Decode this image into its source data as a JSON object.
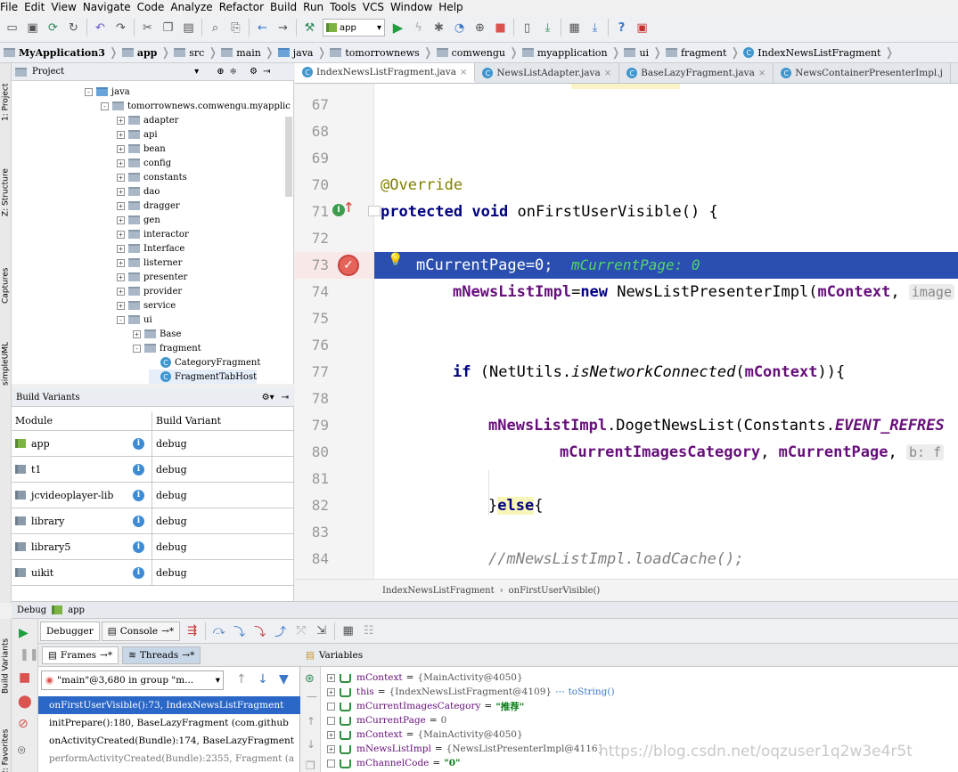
{
  "menu": [
    "File",
    "Edit",
    "View",
    "Navigate",
    "Code",
    "Analyze",
    "Refactor",
    "Build",
    "Run",
    "Tools",
    "VCS",
    "Window",
    "Help"
  ],
  "toolbar": {
    "run_config": "app"
  },
  "breadcrumb": [
    "MyApplication3",
    "app",
    "src",
    "main",
    "java",
    "tomorrownews",
    "comwengu",
    "myapplication",
    "ui",
    "fragment",
    "IndexNewsListFragment"
  ],
  "left_strip": {
    "project": "1: Project",
    "structure": "Z: Structure",
    "captures": "Captures",
    "simpleuml": "simpleUML",
    "build_variants": "Build Variants",
    "favorites": "2: Favorites"
  },
  "project_panel": {
    "title": "Project",
    "tree": [
      {
        "label": "java",
        "kind": "folder",
        "expander": "-"
      },
      {
        "label": "tomorrownews.comwengu.myapplic",
        "kind": "package",
        "expander": "-"
      },
      {
        "label": "adapter",
        "kind": "package",
        "expander": "+"
      },
      {
        "label": "api",
        "kind": "package",
        "expander": "+"
      },
      {
        "label": "bean",
        "kind": "package",
        "expander": "+"
      },
      {
        "label": "config",
        "kind": "package",
        "expander": "+"
      },
      {
        "label": "constants",
        "kind": "package",
        "expander": "+"
      },
      {
        "label": "dao",
        "kind": "package",
        "expander": "+"
      },
      {
        "label": "dragger",
        "kind": "package",
        "expander": "+"
      },
      {
        "label": "gen",
        "kind": "package",
        "expander": "+"
      },
      {
        "label": "interactor",
        "kind": "package",
        "expander": "+"
      },
      {
        "label": "Interface",
        "kind": "package",
        "expander": "+"
      },
      {
        "label": "listerner",
        "kind": "package",
        "expander": "+"
      },
      {
        "label": "presenter",
        "kind": "package",
        "expander": "+"
      },
      {
        "label": "provider",
        "kind": "package",
        "expander": "+"
      },
      {
        "label": "service",
        "kind": "package",
        "expander": "+"
      },
      {
        "label": "ui",
        "kind": "package",
        "expander": "-"
      },
      {
        "label": "Base",
        "kind": "package",
        "expander": "+"
      },
      {
        "label": "fragment",
        "kind": "package",
        "expander": "-"
      },
      {
        "label": "CategoryFragment",
        "kind": "class",
        "expander": ""
      },
      {
        "label": "FragmentTabHost",
        "kind": "class",
        "expander": ""
      }
    ]
  },
  "build_variants": {
    "title": "Build Variants",
    "col_module": "Module",
    "col_variant": "Build Variant",
    "rows": [
      {
        "module": "app",
        "variant": "debug"
      },
      {
        "module": "t1",
        "variant": "debug"
      },
      {
        "module": "jcvideoplayer-lib",
        "variant": "debug"
      },
      {
        "module": "library",
        "variant": "debug"
      },
      {
        "module": "library5",
        "variant": "debug"
      },
      {
        "module": "uikit",
        "variant": "debug"
      }
    ]
  },
  "editor_tabs": [
    "IndexNewsListFragment.java",
    "NewsListAdapter.java",
    "BaseLazyFragment.java",
    "NewsContainerPresenterImpl.j"
  ],
  "editor": {
    "line_numbers": [
      "67",
      "68",
      "69",
      "70",
      "71",
      "72",
      "73",
      "74",
      "75",
      "76",
      "77",
      "78",
      "79",
      "80",
      "81",
      "82",
      "83",
      "84"
    ],
    "l70": "@Override",
    "l71_kw": "protected void",
    "l71_rest": "onFirstUserVisible() {",
    "l73_code": "mCurrentPage=0;",
    "l73_inline": "mCurrentPage: 0",
    "l74_field": "mNewsListImpl",
    "l74_op": "=",
    "l74_kw": "new",
    "l74_rest": "NewsListPresenterImpl(",
    "l74_arg": "mContext",
    "l74_comma": ",",
    "l74_hint": "image",
    "l77_kw": "if",
    "l77_a": "(NetUtils.",
    "l77_method": "isNetworkConnected",
    "l77_b": "(",
    "l77_arg": "mContext",
    "l77_c": ")){",
    "l79_field": "mNewsListImpl",
    "l79_a": ".DogetNewsList(Constants.",
    "l79_const": "EVENT_REFRES",
    "l80_a": "mCurrentImagesCategory",
    "l80_sep": ",",
    "l80_b": "mCurrentPage",
    "l80_comma": ",",
    "l80_hint": "b: f",
    "l82_a": "}",
    "l82_kw": "else",
    "l82_b": "{",
    "l84": "//mNewsListImpl.loadCache();"
  },
  "editor_breadcrumb": {
    "file": "IndexNewsListFragment",
    "sep": "›",
    "method": "onFirstUserVisible()"
  },
  "debug": {
    "label": "Debug",
    "config": "app",
    "tab_debugger": "Debugger",
    "tab_console": "Console",
    "tab_frames": "Frames",
    "tab_threads": "Threads",
    "thread": "\"main\"@3,680 in group \"m...",
    "frames": [
      "onFirstUserVisible():73, IndexNewsListFragment",
      "initPrepare():180, BaseLazyFragment (com.github",
      "onActivityCreated(Bundle):174, BaseLazyFragment",
      "performActivityCreated(Bundle):2355, Fragment (a"
    ],
    "variables_title": "Variables",
    "variables": [
      {
        "name": "mContext",
        "eq": "=",
        "value": "{MainActivity@4050}",
        "kind": "obj"
      },
      {
        "name": "this",
        "eq": "=",
        "value": "{IndexNewsListFragment@4109}",
        "link": "toString()",
        "kind": "obj"
      },
      {
        "name": "mCurrentImagesCategory",
        "eq": "=",
        "value": "\"推荐\"",
        "kind": "str"
      },
      {
        "name": "mCurrentPage",
        "eq": "=",
        "value": "0",
        "kind": "num"
      },
      {
        "name": "mContext",
        "eq": "=",
        "value": "{MainActivity@4050}",
        "kind": "obj"
      },
      {
        "name": "mNewsListImpl",
        "eq": "=",
        "value": "{NewsListPresenterImpl@4116}",
        "kind": "obj"
      },
      {
        "name": "mChannelCode",
        "eq": "=",
        "value": "\"0\"",
        "kind": "str"
      }
    ]
  },
  "watermark": "https://blog.csdn.net/oqzuser1q2w3e4r5t",
  "colors": {
    "selection": "#2a4fb0",
    "keyword": "#000080",
    "field": "#660e7a",
    "annotation": "#808000",
    "frame_selected": "#2a67c7"
  }
}
